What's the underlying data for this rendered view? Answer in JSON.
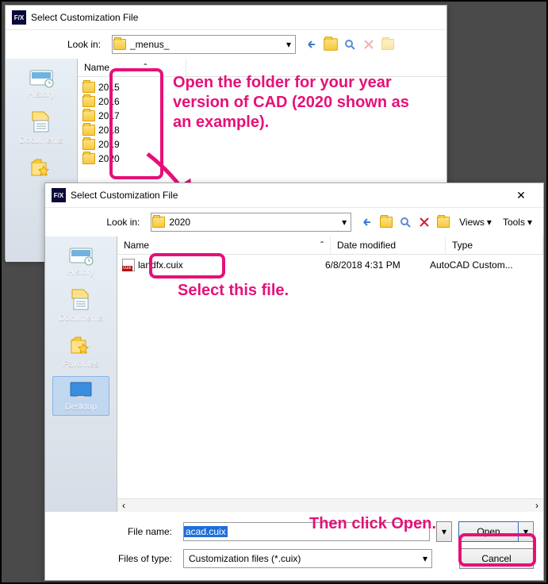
{
  "d1": {
    "title": "Select Customization File",
    "lookin_label": "Look in:",
    "lookin_value": "_menus_",
    "columns": {
      "name": "Name"
    },
    "folders": [
      "2015",
      "2016",
      "2017",
      "2018",
      "2019",
      "2020"
    ],
    "sidebar": [
      "History",
      "Documents"
    ]
  },
  "d2": {
    "title": "Select Customization File",
    "lookin_label": "Look in:",
    "lookin_value": "2020",
    "views_label": "Views",
    "tools_label": "Tools",
    "columns": {
      "name": "Name",
      "date": "Date modified",
      "type": "Type"
    },
    "file": {
      "name": "landfx.cuix",
      "date": "6/8/2018 4:31 PM",
      "type": "AutoCAD Custom..."
    },
    "sidebar": [
      "History",
      "Documents",
      "Favorites",
      "Desktop"
    ],
    "filename_label": "File name:",
    "filename_value": "acad.cuix",
    "filetype_label": "Files of type:",
    "filetype_value": "Customization files (*.cuix)",
    "open_label": "Open",
    "cancel_label": "Cancel"
  },
  "anno": {
    "a1": "Open the folder for your year version of CAD (2020 shown as an example).",
    "a2": "Select this file.",
    "a3": "Then click Open."
  },
  "colors": {
    "pink": "#e61079"
  }
}
